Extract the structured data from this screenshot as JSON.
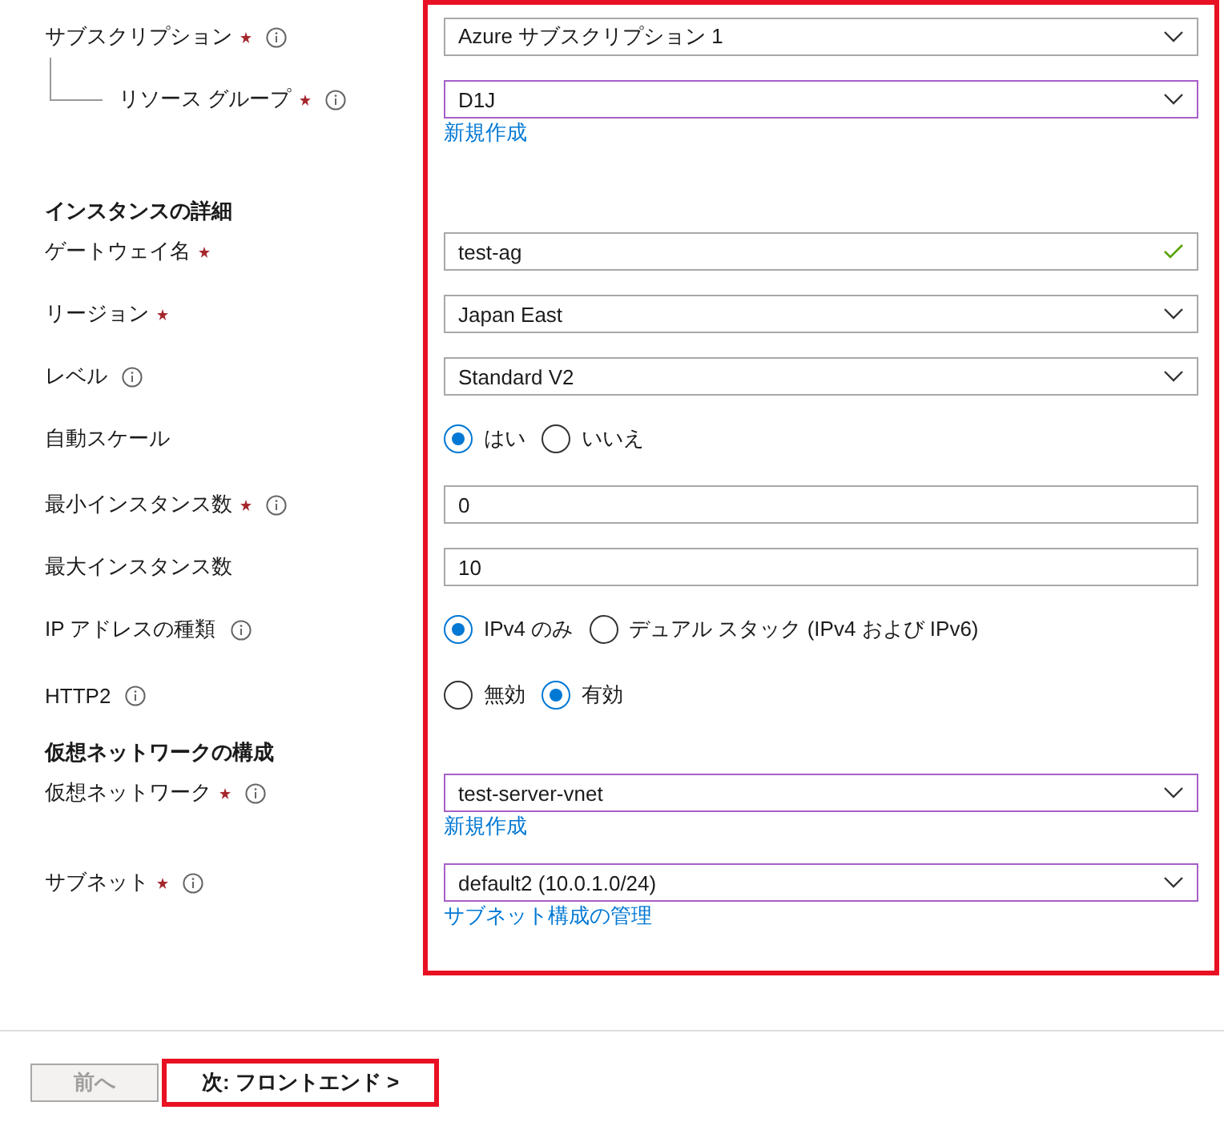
{
  "form": {
    "highlighted": true,
    "rows": [
      {
        "kind": "select",
        "label": "サブスクリプション",
        "required": true,
        "info": true,
        "value": "Azure サブスクリプション 1",
        "focused": false
      },
      {
        "kind": "select",
        "label": "リソース グループ",
        "required": true,
        "info": true,
        "child": true,
        "value": "D1J",
        "focused": true,
        "link": "新規作成"
      },
      {
        "kind": "heading",
        "label": "インスタンスの詳細"
      },
      {
        "kind": "text",
        "label": "ゲートウェイ名",
        "required": true,
        "value": "test-ag",
        "valid": true
      },
      {
        "kind": "select",
        "label": "リージョン",
        "required": true,
        "value": "Japan East",
        "focused": false
      },
      {
        "kind": "select",
        "label": "レベル",
        "info": true,
        "value": "Standard V2",
        "focused": false
      },
      {
        "kind": "radio",
        "label": "自動スケール",
        "options": [
          {
            "label": "はい",
            "selected": true
          },
          {
            "label": "いいえ",
            "selected": false
          }
        ]
      },
      {
        "kind": "text",
        "label": "最小インスタンス数",
        "required": true,
        "info": true,
        "value": "0"
      },
      {
        "kind": "text",
        "label": "最大インスタンス数",
        "value": "10"
      },
      {
        "kind": "radio",
        "label": "IP アドレスの種類",
        "info": true,
        "options": [
          {
            "label": "IPv4 のみ",
            "selected": true
          },
          {
            "label": "デュアル スタック (IPv4 および IPv6)",
            "selected": false
          }
        ]
      },
      {
        "kind": "radio",
        "label": "HTTP2",
        "info": true,
        "options": [
          {
            "label": "無効",
            "selected": false
          },
          {
            "label": "有効",
            "selected": true
          }
        ]
      },
      {
        "kind": "heading",
        "label": "仮想ネットワークの構成"
      },
      {
        "kind": "select",
        "label": "仮想ネットワーク",
        "required": true,
        "info": true,
        "value": "test-server-vnet",
        "focused": true,
        "link": "新規作成"
      },
      {
        "kind": "select",
        "label": "サブネット",
        "required": true,
        "info": true,
        "value": "default2 (10.0.1.0/24)",
        "focused": true,
        "link": "サブネット構成の管理"
      }
    ]
  },
  "buttons": [
    {
      "label": "前へ",
      "disabled": true,
      "highlighted": false
    },
    {
      "label": "次: フロントエンド >",
      "disabled": false,
      "highlighted": true
    }
  ]
}
